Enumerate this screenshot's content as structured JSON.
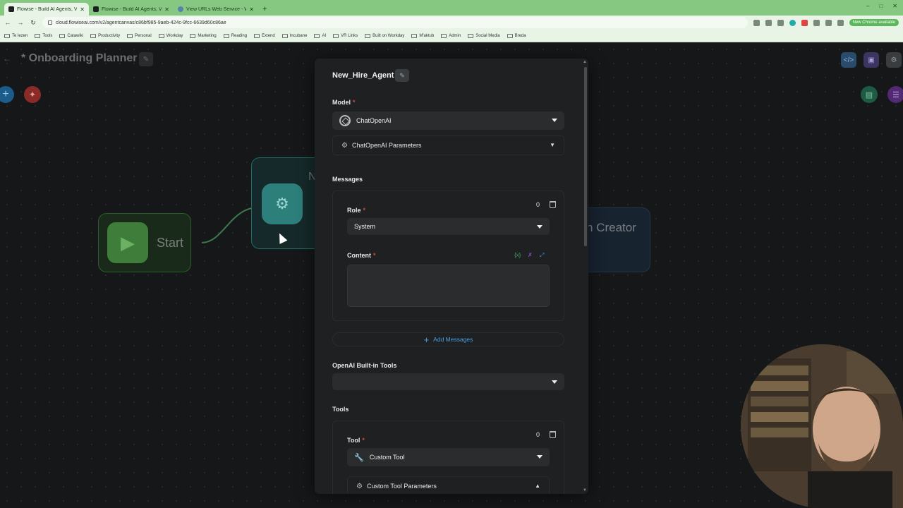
{
  "browser": {
    "tabs": [
      {
        "title": "Flowise - Build AI Agents, Visua",
        "icon": "flowise-icon",
        "active": true
      },
      {
        "title": "Flowise - Build AI Agents, Visua",
        "icon": "flowise-icon",
        "active": false
      },
      {
        "title": "View URLs Web Service - Work",
        "icon": "globe-icon",
        "active": false
      }
    ],
    "new_tab": "+",
    "url": "cloud.flowiseai.com/v2/agentcanvas/c86bf985-9aeb-424c-9fcc-6639d60c86ae",
    "badge": "New Chrome available",
    "bookmarks": [
      "Te lezen",
      "Tools",
      "Catawiki",
      "Productivity",
      "Personal",
      "Workday",
      "Marketing",
      "Reading",
      "Extend",
      "Incubane",
      "AI",
      "VR Links",
      "Built on Workday",
      "M'aktub",
      "Admin",
      "Social Media",
      "Breda"
    ]
  },
  "canvas": {
    "title": "* Onboarding Planner",
    "nodes": {
      "start": "Start",
      "agent_partial": "N",
      "creator_partial": "n Creator"
    }
  },
  "dialog": {
    "name": "New_Hire_Agent",
    "model": {
      "label": "Model",
      "value": "ChatOpenAI",
      "params": "ChatOpenAI Parameters"
    },
    "messages": {
      "label": "Messages",
      "count": "0",
      "role_label": "Role",
      "role_value": "System",
      "content_label": "Content",
      "add_button": "Add Messages"
    },
    "builtin_tools": {
      "label": "OpenAI Built-in Tools",
      "value": ""
    },
    "tools": {
      "label": "Tools",
      "count": "0",
      "tool_label": "Tool",
      "tool_value": "Custom Tool",
      "params": "Custom Tool Parameters"
    }
  },
  "colors": {
    "required": "#d04a4a",
    "accent_blue": "#4a9fe0",
    "tabbar_green": "#86c882"
  }
}
